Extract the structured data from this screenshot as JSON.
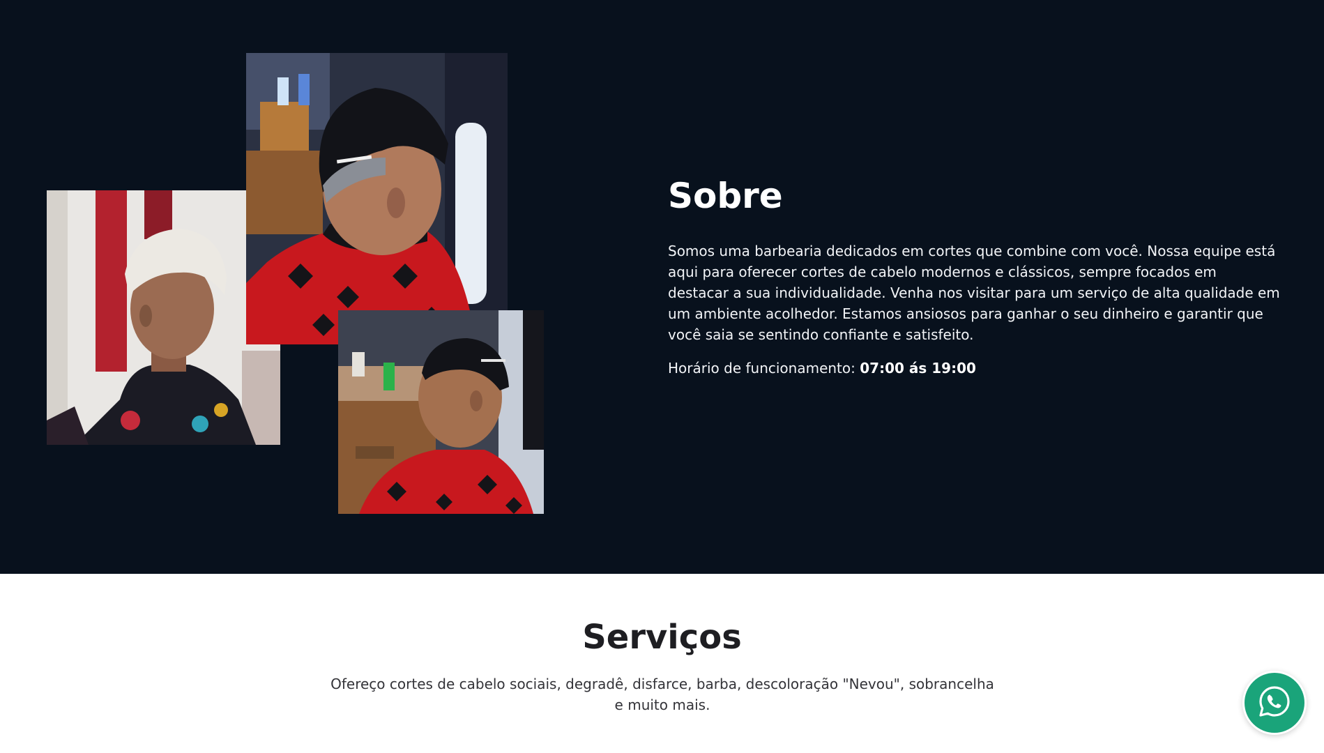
{
  "about": {
    "title": "Sobre",
    "description": "Somos uma barbearia dedicados em cortes que combine com você. Nossa equipe está aqui para oferecer cortes de cabelo modernos e clássicos, sempre focados em destacar a sua individualidade. Venha nos visitar para um serviço de alta qualidade em um ambiente acolhedor. Estamos ansiosos para ganhar o seu dinheiro e garantir que você saia se sentindo confiante e satisfeito.",
    "hours_label": "Horário de funcionamento:",
    "hours_value": "07:00 ás 19:00",
    "background_color": "#08111d"
  },
  "services": {
    "title": "Serviços",
    "description_line1": "Ofereço cortes de cabelo sociais, degradê, disfarce, barba, descoloração \"Nevou\", sobrancelha",
    "description_line2": "e muito mais."
  },
  "whatsapp": {
    "icon": "whatsapp-icon",
    "color": "#1aa47a"
  }
}
